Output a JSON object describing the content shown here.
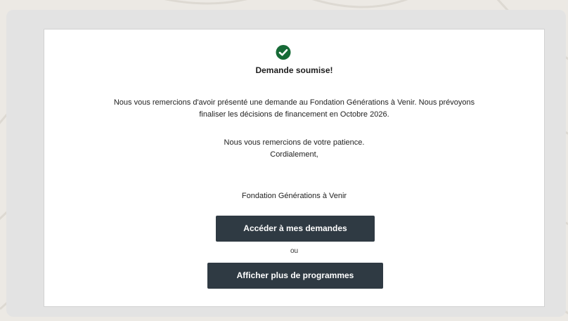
{
  "confirmation": {
    "icon": "check-circle-icon",
    "title": "Demande soumise!",
    "message_line1": "Nous vous remercions d'avoir présenté une demande au Fondation Générations à Venir. Nous prévoyons",
    "message_line2": "finaliser les décisions de financement en Octobre 2026.",
    "patience": "Nous vous remercions de votre patience.",
    "regards": "Cordialement,",
    "organization": "Fondation Générations à Venir"
  },
  "actions": {
    "primary_label": "Accéder à mes demandes",
    "separator": "ou",
    "secondary_label": "Afficher plus de programmes"
  },
  "colors": {
    "success_green": "#166a36",
    "button_bg": "#2f3a43",
    "page_bg": "#ece9e4",
    "panel_bg": "#e3e3e3"
  }
}
